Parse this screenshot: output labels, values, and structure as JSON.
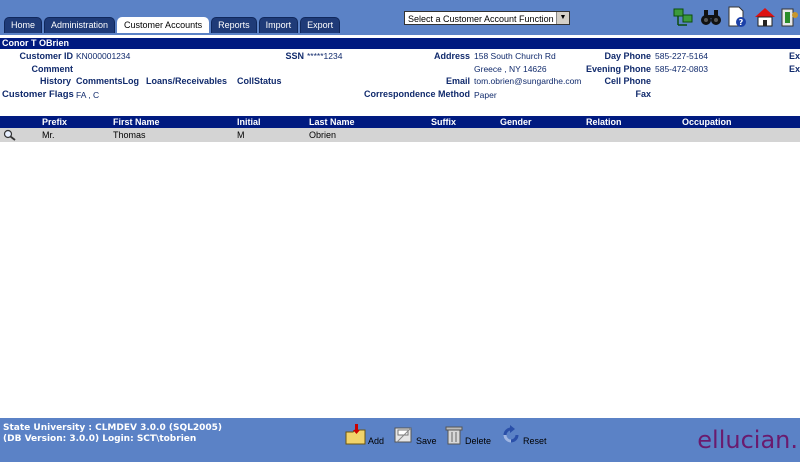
{
  "tabs": [
    "Home",
    "Administration",
    "Customer Accounts",
    "Reports",
    "Import",
    "Export"
  ],
  "active_tab": "Customer Accounts",
  "function_select": {
    "value": "Select a Customer Account Function"
  },
  "toolbar_icons": [
    "network-icon",
    "binoculars-icon",
    "help-document-icon",
    "home-icon",
    "exit-icon"
  ],
  "customer": {
    "name": "Conor T OBrien",
    "customer_id_label": "Customer ID",
    "customer_id": "KN000001234",
    "ssn_label": "SSN",
    "ssn": "*****1234",
    "comment_label": "Comment",
    "comment": "",
    "address_label": "Address",
    "address_line1": "158 South Church Rd",
    "address_line2": "Greece , NY 14626",
    "email_label": "Email",
    "email": "tom.obrien@sungardhe.com",
    "correspondence_label": "Correspondence Method",
    "correspondence": "Paper",
    "day_phone_label": "Day Phone",
    "day_phone": "585-227-5164",
    "evening_phone_label": "Evening Phone",
    "evening_phone": "585-472-0803",
    "cell_phone_label": "Cell Phone",
    "cell_phone": "",
    "fax_label": "Fax",
    "fax": "",
    "flags_label": "Customer Flags",
    "flags": "FA , C",
    "ext1": "Ex",
    "ext2": "Ex"
  },
  "links": [
    "History",
    "CommentsLog",
    "Loans/Receivables",
    "CollStatus"
  ],
  "table": {
    "headers": [
      "Prefix",
      "First Name",
      "Initial",
      "Last Name",
      "Suffix",
      "Gender",
      "Relation",
      "Occupation"
    ],
    "rows": [
      [
        "Mr.",
        "Thomas",
        "M",
        "Obrien",
        "",
        "",
        "",
        ""
      ]
    ]
  },
  "footer": {
    "line1": "State University : CLMDEV 3.0.0 (SQL2005)",
    "line2": "(DB Version: 3.0.0) Login: SCT\\tobrien",
    "buttons": {
      "add": "Add",
      "save": "Save",
      "delete": "Delete",
      "reset": "Reset"
    },
    "logo": "ellucian."
  },
  "colors": {
    "bar": "#5b82c6",
    "header": "#001a80",
    "label": "#102a6c",
    "row": "#d4d4d4",
    "logo": "#6a1b6e"
  }
}
